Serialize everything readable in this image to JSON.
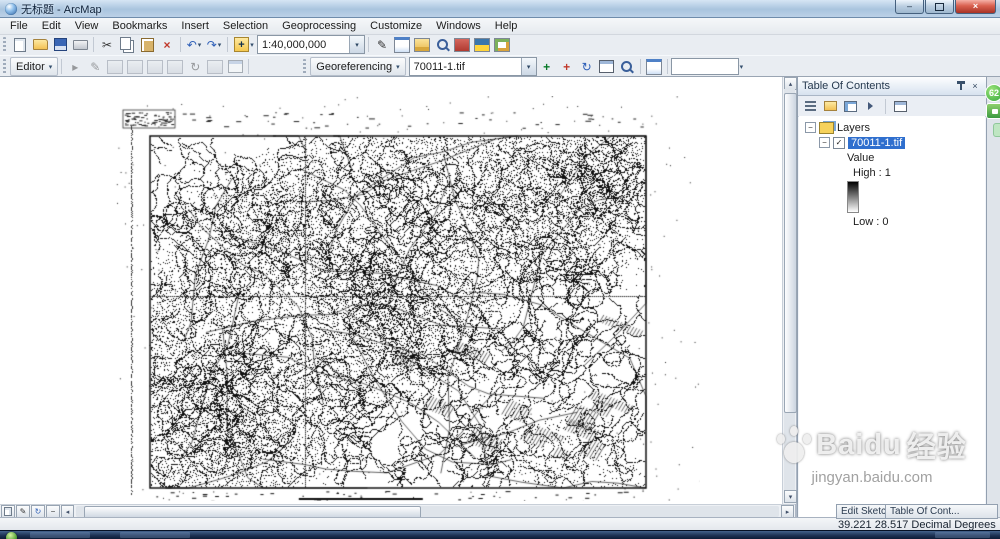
{
  "window": {
    "title": "无标题 - ArcMap"
  },
  "menubar": {
    "items": [
      "File",
      "Edit",
      "View",
      "Bookmarks",
      "Insert",
      "Selection",
      "Geoprocessing",
      "Customize",
      "Windows",
      "Help"
    ]
  },
  "toolbars": {
    "scale_combo": "1:40,000,000",
    "editor_label": "Editor",
    "georeferencing_label": "Georeferencing",
    "georef_layer_combo": "70011-1.tif",
    "georef_textbox": ""
  },
  "toc": {
    "title": "Table Of Contents",
    "layers": "Layers",
    "layer_name": "70011-1.tif",
    "value_label": "Value",
    "high_label": "High : 1",
    "low_label": "Low : 0"
  },
  "bottom_tabs": {
    "sketch": "Edit Sketch Prop...",
    "toc": "Table Of Cont..."
  },
  "status": {
    "coordinates": "39.221  28.517 Decimal Degrees"
  },
  "watermark": {
    "brand": "Baidu",
    "brand_cn": "经验",
    "url": "jingyan.baidu.com"
  },
  "overlay": {
    "badge_count": "62"
  },
  "colors": {
    "selection_blue": "#2f6fce",
    "badge_green": "#37a93c",
    "titlebar_blue": "#a9c4de"
  },
  "icons": {
    "dropdown-arrow": "▾",
    "cut": "✂",
    "delete": "×",
    "undo": "↶",
    "redo": "↷",
    "pencil": "✎",
    "edit-arrow": "▸",
    "rotate": "↻",
    "add-control-point": "+",
    "check": "✓",
    "collapse": "−",
    "close": "×",
    "minimize": "–",
    "scroll-left": "◂",
    "scroll-right": "▸",
    "scroll-up": "▴",
    "scroll-down": "▾"
  }
}
